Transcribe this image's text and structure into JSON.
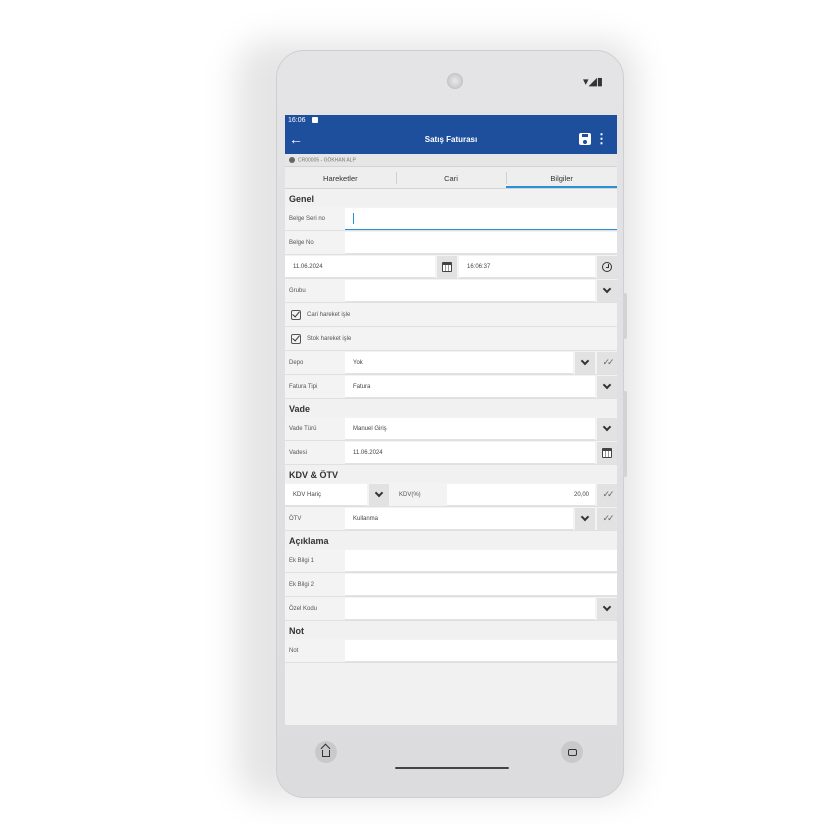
{
  "status": {
    "time": "16:06",
    "hw_icons": "▾◢▮"
  },
  "header": {
    "title": "Satış Faturası"
  },
  "user_line": "CR00005 - GÖKHAN ALP",
  "tabs": [
    "Hareketler",
    "Cari",
    "Bilgiler"
  ],
  "active_tab": "Bilgiler",
  "sections": {
    "genel": "Genel",
    "vade": "Vade",
    "kdv": "KDV & ÖTV",
    "aciklama": "Açıklama",
    "not": "Not"
  },
  "genel": {
    "belge_seri_label": "Belge Seri no",
    "belge_no_label": "Belge No",
    "date": "11.06.2024",
    "time": "16:06:37",
    "grubu_label": "Grubu",
    "cari_check": "Cari hareket işle",
    "stok_check": "Stok hareket işle",
    "depo_label": "Depo",
    "depo_value": "Yok",
    "fatura_tipi_label": "Fatura Tipi",
    "fatura_tipi_value": "Fatura"
  },
  "vade": {
    "vade_turu_label": "Vade Türü",
    "vade_turu_value": "Manuel Giriş",
    "vadesi_label": "Vadesi",
    "vadesi_value": "11.06.2024"
  },
  "kdv": {
    "kdv_mode": "KDV Hariç",
    "kdv_pct_label": "KDV(%)",
    "kdv_pct_value": "20,00",
    "otv_label": "ÖTV",
    "otv_value": "Kullanma"
  },
  "aciklama": {
    "ek1_label": "Ek Bilgi 1",
    "ek2_label": "Ek Bilgi 2",
    "ozel_label": "Özel Kodu"
  },
  "not": {
    "not_label": "Not"
  },
  "colors": {
    "appbar": "#1e4f9c",
    "accent": "#2a90d8"
  }
}
